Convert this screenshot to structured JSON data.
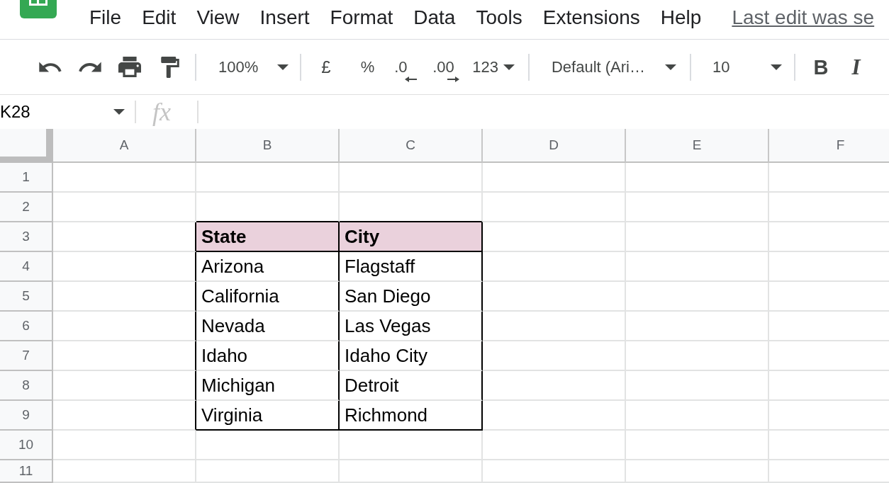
{
  "menu_bar": {
    "items": [
      "File",
      "Edit",
      "View",
      "Insert",
      "Format",
      "Data",
      "Tools",
      "Extensions",
      "Help"
    ],
    "last_edit": "Last edit was se"
  },
  "toolbar": {
    "zoom": "100%",
    "currency": "£",
    "percent": "%",
    "decimals": [
      {
        "label": ".0",
        "kind": "decrease"
      },
      {
        "label": ".00",
        "kind": "increase"
      }
    ],
    "number_formats": "123",
    "font": "Default (Ari…",
    "font_size": "10",
    "bold": "B",
    "italic": "I"
  },
  "formula_bar": {
    "name_box": "K28",
    "function_label": "fx"
  },
  "sheet": {
    "columns": [
      "A",
      "B",
      "C",
      "D",
      "E",
      "F"
    ],
    "row_numbers": [
      "1",
      "2",
      "3",
      "4",
      "5",
      "6",
      "7",
      "8",
      "9",
      "10",
      "11"
    ],
    "table": {
      "header": [
        "State",
        "City"
      ],
      "rows": [
        [
          "Arizona",
          "Flagstaff"
        ],
        [
          "California",
          "San Diego"
        ],
        [
          "Nevada",
          "Las Vegas"
        ],
        [
          "Idaho",
          "Idaho City"
        ],
        [
          "Michigan",
          "Detroit"
        ],
        [
          "Virginia",
          "Richmond"
        ]
      ]
    }
  }
}
